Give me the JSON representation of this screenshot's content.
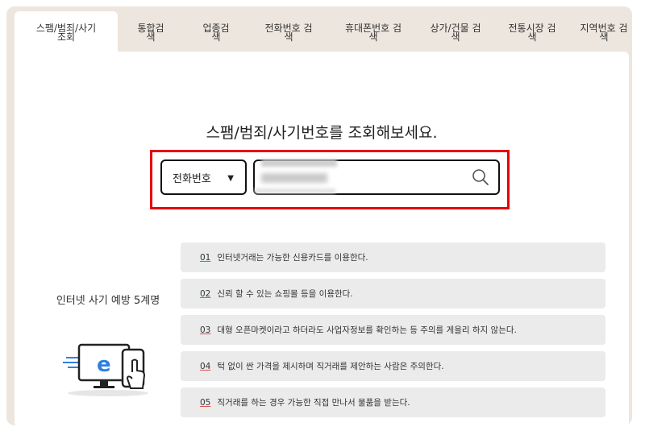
{
  "tabs": [
    {
      "label": "스팸/범죄/사기 조회",
      "active": true
    },
    {
      "label": "통합검색"
    },
    {
      "label": "업종검색"
    },
    {
      "label": "전화번호 검색"
    },
    {
      "label": "휴대폰번호 검색"
    },
    {
      "label": "상가/건물 검색"
    },
    {
      "label": "전통시장 검색"
    },
    {
      "label": "지역번호 검색"
    }
  ],
  "search": {
    "headline": "스팸/범죄/사기번호를 조회해보세요.",
    "select_value": "전화번호",
    "caret": "▼",
    "highlight_color": "#e8000b"
  },
  "prevention": {
    "heading": "인터넷 사기 예방 5계명",
    "tips": [
      {
        "num": "01",
        "text": "인터넷거래는 가능한 신용카드를 이용한다."
      },
      {
        "num": "02",
        "text": "신뢰 할 수 있는 쇼핑몰 등을 이용한다."
      },
      {
        "num": "03",
        "text": "대형 오픈마켓이라고 하더라도 사업자정보를 확인하는 등 주의를 게을리 하지 않는다."
      },
      {
        "num": "04",
        "text": "턱 없이 싼 가격을 제시하며 직거래를 제안하는 사람은 주의한다."
      },
      {
        "num": "05",
        "text": "직거래를 하는 경우 가능한 직접 만나서 물품을 받는다."
      }
    ],
    "illustration_letter": "e"
  }
}
